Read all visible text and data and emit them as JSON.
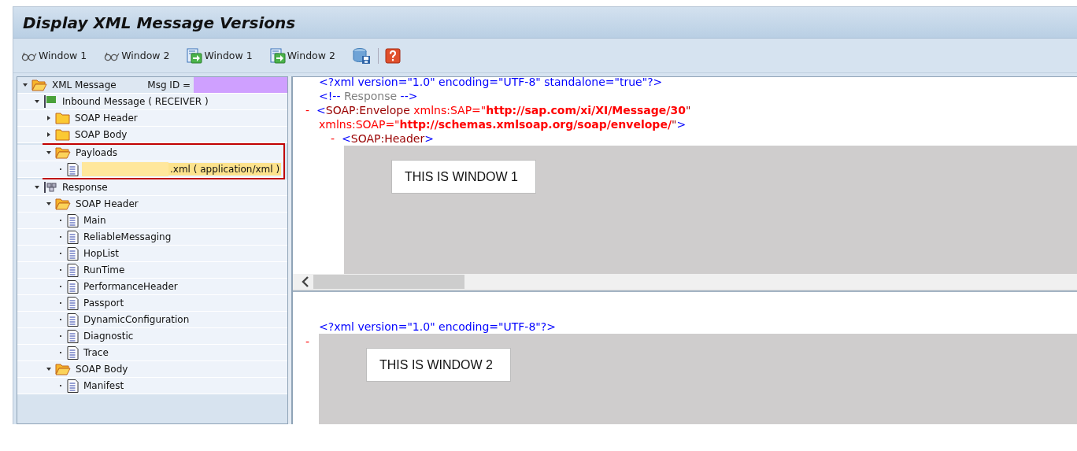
{
  "window": {
    "title": "Display XML Message Versions"
  },
  "toolbar": [
    {
      "kind": "glasses",
      "label": "Window 1"
    },
    {
      "kind": "glasses",
      "label": "Window 2"
    },
    {
      "kind": "document-arrow",
      "label": "Window 1"
    },
    {
      "kind": "document-arrow",
      "label": "Window 2"
    },
    {
      "kind": "database-save"
    },
    {
      "kind": "help"
    }
  ],
  "tree": {
    "items": [
      {
        "label": "XML Message",
        "kind": "folder",
        "expanded": true,
        "selected": false,
        "highlighted": false,
        "msg_id": {
          "label": "Msg ID =",
          "redacted": true
        },
        "children": [
          {
            "label": "Inbound Message ( RECEIVER )",
            "kind": "flag",
            "expanded": true,
            "selected": false,
            "highlighted": false,
            "children": [
              {
                "label": "SOAP Header",
                "kind": "folder",
                "expanded": false,
                "selected": false,
                "highlighted": false
              },
              {
                "label": "SOAP Body",
                "kind": "folder",
                "expanded": false,
                "selected": false,
                "highlighted": false
              },
              {
                "label": "Payloads",
                "kind": "folder",
                "expanded": true,
                "selected": false,
                "highlighted": true,
                "children": [
                  {
                    "label": ".xml ( application/xml )",
                    "kind": "document",
                    "selected": true,
                    "highlighted": false,
                    "redacted": true
                  }
                ]
              }
            ]
          },
          {
            "label": "Response",
            "kind": "stack",
            "expanded": true,
            "selected": false,
            "highlighted": false,
            "children": [
              {
                "label": "SOAP Header",
                "kind": "folder",
                "expanded": true,
                "selected": false,
                "highlighted": false,
                "children": [
                  {
                    "label": "Main",
                    "kind": "document",
                    "selected": false,
                    "highlighted": false
                  },
                  {
                    "label": "ReliableMessaging",
                    "kind": "document",
                    "selected": false,
                    "highlighted": false
                  },
                  {
                    "label": "HopList",
                    "kind": "document",
                    "selected": false,
                    "highlighted": false
                  },
                  {
                    "label": "RunTime",
                    "kind": "document",
                    "selected": false,
                    "highlighted": false
                  },
                  {
                    "label": "PerformanceHeader",
                    "kind": "document",
                    "selected": false,
                    "highlighted": false
                  },
                  {
                    "label": "Passport",
                    "kind": "document",
                    "selected": false,
                    "highlighted": false
                  },
                  {
                    "label": "DynamicConfiguration",
                    "kind": "document",
                    "selected": false,
                    "highlighted": false
                  },
                  {
                    "label": "Diagnostic",
                    "kind": "document",
                    "selected": false,
                    "highlighted": false
                  },
                  {
                    "label": "Trace",
                    "kind": "document",
                    "selected": false,
                    "highlighted": false
                  }
                ]
              },
              {
                "label": "SOAP Body",
                "kind": "folder",
                "expanded": true,
                "selected": false,
                "highlighted": false,
                "children": [
                  {
                    "label": "Manifest",
                    "kind": "document",
                    "selected": false,
                    "highlighted": false
                  }
                ]
              }
            ]
          }
        ]
      }
    ]
  },
  "panes": [
    {
      "lines": [
        {
          "kind": "line",
          "segments": [
            {
              "kind": "punct",
              "text": "<?xml version=\"1.0\" encoding=\"UTF-8\" standalone=\"true\"?>"
            }
          ]
        },
        {
          "kind": "line",
          "segments": [
            {
              "kind": "punct",
              "text": "<!--"
            },
            {
              "kind": "comment",
              "text": " Response "
            },
            {
              "kind": "punct",
              "text": "-->"
            }
          ]
        },
        {
          "kind": "line",
          "marker": "-",
          "segments": [
            {
              "kind": "punct",
              "text": "<"
            },
            {
              "kind": "tag",
              "text": "SOAP:Envelope"
            },
            {
              "kind": "attr",
              "text": " xmlns:SAP=\""
            },
            {
              "kind": "value",
              "text": "http://sap.com/xi/XI/Message/30"
            },
            {
              "kind": "tag",
              "text": "\""
            }
          ],
          "continuation": [
            {
              "kind": "attr",
              "text": "xmlns:SOAP=\""
            },
            {
              "kind": "value",
              "text": "http://schemas.xmlsoap.org/soap/envelope/"
            },
            {
              "kind": "tag",
              "text": "\""
            },
            {
              "kind": "punct",
              "text": ">"
            }
          ],
          "children": [
            {
              "kind": "line",
              "marker": "-",
              "segments": [
                {
                  "kind": "punct",
                  "text": "<"
                },
                {
                  "kind": "tag",
                  "text": "SOAP:Header"
                },
                {
                  "kind": "punct",
                  "text": ">"
                }
              ],
              "children": [
                {
                  "kind": "overlay",
                  "label": "THIS IS WINDOW 1"
                }
              ]
            }
          ]
        }
      ]
    },
    {
      "lines": [
        {
          "kind": "line",
          "segments": [
            {
              "kind": "punct",
              "text": "<?xml version=\"1.0\" encoding=\"UTF-8\"?>"
            }
          ]
        },
        {
          "kind": "overlay",
          "marker": "-",
          "label": "THIS IS WINDOW 2"
        }
      ]
    }
  ]
}
